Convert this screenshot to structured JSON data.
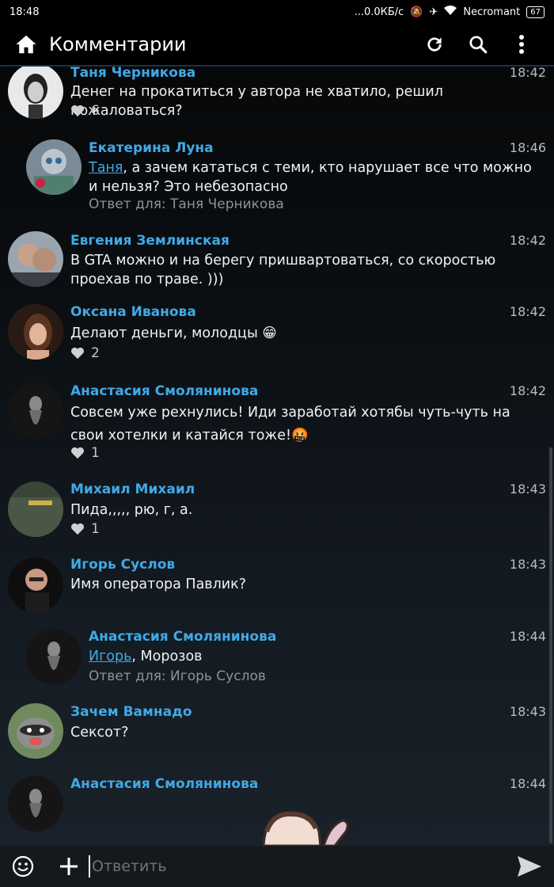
{
  "status": {
    "time": "18:48",
    "network": "...0.0КБ/с",
    "carrier": "Necromant",
    "battery": "67"
  },
  "toolbar": {
    "title": "Комментарии"
  },
  "comments": [
    {
      "name": "Таня Черникова",
      "time": "18:42",
      "text": "Денег на прокатиться у автора не хватило, решил пожаловаться?",
      "likes": "6"
    },
    {
      "name": "Екатерина Луна",
      "time": "18:46",
      "mention": "Таня",
      "text": ", а зачем кататься с теми, кто нарушает все что можно и нельзя? Это небезопасно",
      "reply_to": "Ответ для: Таня Черникова"
    },
    {
      "name": "Евгения Землинская",
      "time": "18:42",
      "text": "В GTA можно и на берегу пришвартоваться, со скоростью проехав по траве. )))"
    },
    {
      "name": "Оксана Иванова",
      "time": "18:42",
      "text": "Делают деньги, молодцы 😁",
      "likes": "2"
    },
    {
      "name": "Анастасия Смолянинова",
      "time": "18:42",
      "text": "Совсем уже рехнулись! Иди заработай хотябы чуть-чуть на свои хотелки и катайся тоже!🤬",
      "likes": "1"
    },
    {
      "name": "Михаил Михаил",
      "time": "18:43",
      "text": "Пида,,,,, рю, г, а.",
      "likes": "1"
    },
    {
      "name": "Игорь Суслов",
      "time": "18:43",
      "text": "Имя оператора Павлик?"
    },
    {
      "name": "Анастасия Смолянинова",
      "time": "18:44",
      "mention": "Игорь",
      "text": ", Морозов",
      "reply_to": "Ответ для: Игорь Суслов"
    },
    {
      "name": "Зачем Вамнадо",
      "time": "18:43",
      "text": "Сексот?"
    },
    {
      "name": "Анастасия Смолянинова",
      "time": "18:44"
    }
  ],
  "composer": {
    "placeholder": "Ответить"
  },
  "colors": {
    "accent": "#41a9e6",
    "background": "#0b0f13",
    "toolbar": "#000000"
  },
  "icons": [
    "home-icon",
    "refresh-icon",
    "search-icon",
    "more-vert-icon",
    "heart-icon",
    "emoji-icon",
    "plus-icon",
    "send-icon"
  ]
}
